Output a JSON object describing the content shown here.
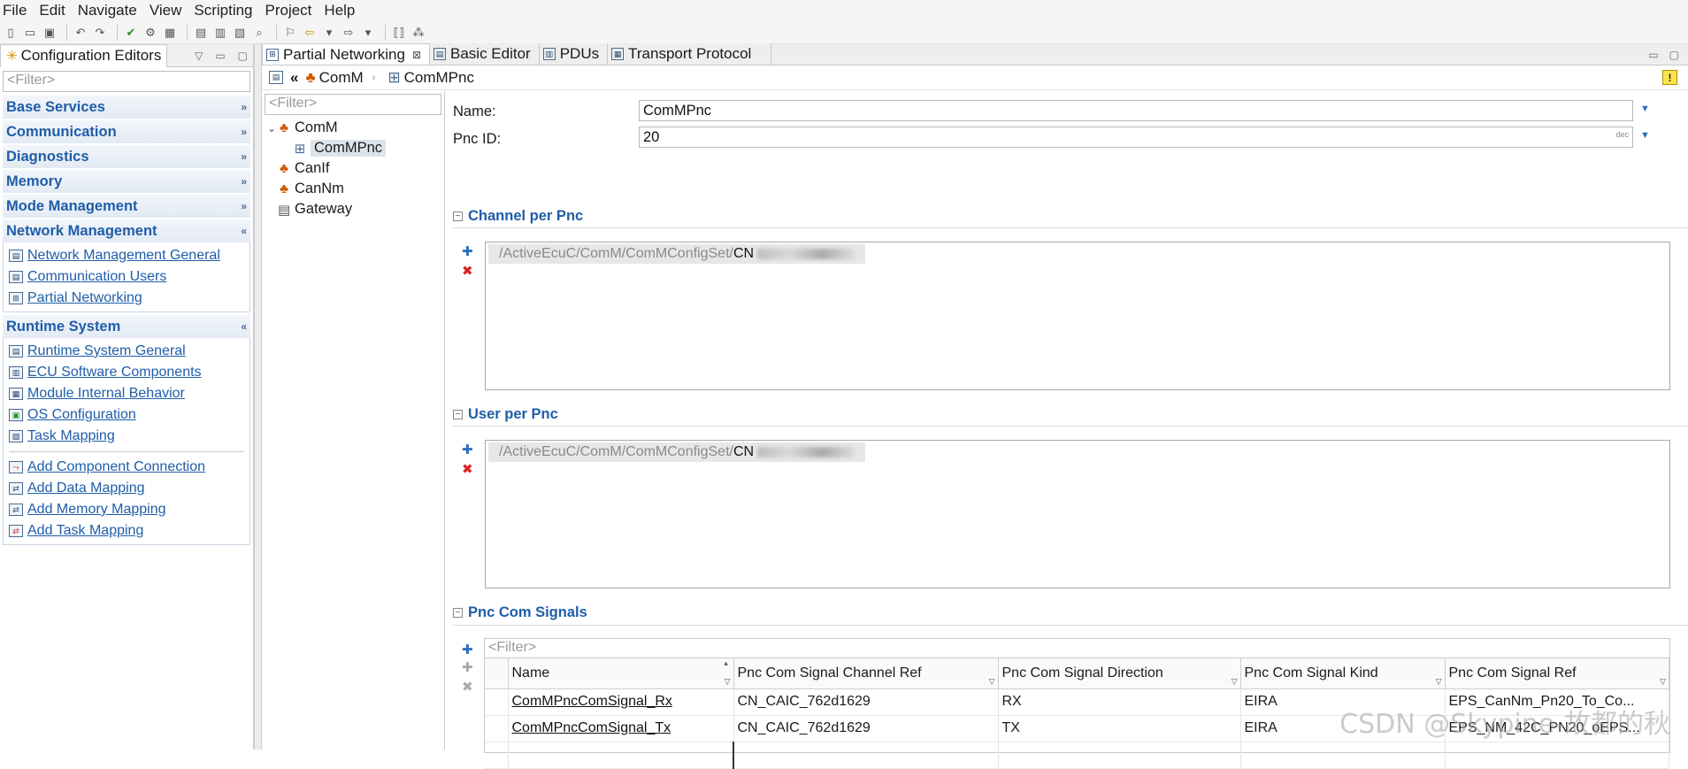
{
  "menu": [
    "File",
    "Edit",
    "Navigate",
    "View",
    "Scripting",
    "Project",
    "Help"
  ],
  "left_panel": {
    "tab_title": "Configuration Editors",
    "filter_placeholder": "<Filter>",
    "sections": [
      {
        "title": "Base Services",
        "expanded": false,
        "items": []
      },
      {
        "title": "Communication",
        "expanded": false,
        "items": []
      },
      {
        "title": "Diagnostics",
        "expanded": false,
        "items": []
      },
      {
        "title": "Memory",
        "expanded": false,
        "items": []
      },
      {
        "title": "Mode Management",
        "expanded": false,
        "items": []
      },
      {
        "title": "Network Management",
        "expanded": true,
        "items": [
          "Network Management General",
          "Communication Users",
          "Partial Networking"
        ]
      },
      {
        "title": "Runtime System",
        "expanded": true,
        "items": [
          "Runtime System General",
          "ECU Software Components",
          "Module Internal Behavior",
          "OS Configuration",
          "Task Mapping"
        ],
        "items2": [
          "Add Component Connection",
          "Add Data Mapping",
          "Add Memory Mapping",
          "Add Task Mapping"
        ]
      }
    ]
  },
  "editor": {
    "tabs": [
      {
        "label": "Partial Networking",
        "active": true
      },
      {
        "label": "Basic Editor",
        "active": false
      },
      {
        "label": "PDUs",
        "active": false
      },
      {
        "label": "Transport Protocol",
        "active": false
      }
    ],
    "breadcrumb": [
      "ComM",
      "ComMPnc"
    ],
    "tree": {
      "filter_placeholder": "<Filter>",
      "nodes": [
        {
          "label": "ComM",
          "level": 0,
          "expanded": true
        },
        {
          "label": "ComMPnc",
          "level": 1,
          "selected": true
        },
        {
          "label": "CanIf",
          "level": 0
        },
        {
          "label": "CanNm",
          "level": 0
        },
        {
          "label": "Gateway",
          "level": 0
        }
      ]
    },
    "form": {
      "name_label": "Name:",
      "name_value": "ComMPnc",
      "pnc_id_label": "Pnc ID:",
      "pnc_id_value": "20",
      "pnc_id_format": "dec",
      "channel_group": "Channel per Pnc",
      "channel_ref_prefix": "/ActiveEcuC/ComM/ComMConfigSet/",
      "channel_ref_suffix": "CN",
      "user_group": "User per Pnc",
      "user_ref_prefix": "/ActiveEcuC/ComM/ComMConfigSet/",
      "user_ref_suffix": "CN",
      "signals_group": "Pnc Com Signals",
      "signals_filter_placeholder": "<Filter>",
      "signals_columns": [
        "Name",
        "Pnc Com Signal Channel Ref",
        "Pnc Com Signal Direction",
        "Pnc Com Signal Kind",
        "Pnc Com Signal Ref"
      ],
      "signals_rows": [
        [
          "ComMPncComSignal_Rx",
          "CN_CAIC_762d1629",
          "RX",
          "EIRA",
          "EPS_CanNm_Pn20_To_Co..."
        ],
        [
          "ComMPncComSignal_Tx",
          "CN_CAIC_762d1629",
          "TX",
          "EIRA",
          "EPS_NM_42C_PN20_oEPS..."
        ]
      ]
    }
  },
  "watermark": "CSDN @Skypine-故都的秋"
}
